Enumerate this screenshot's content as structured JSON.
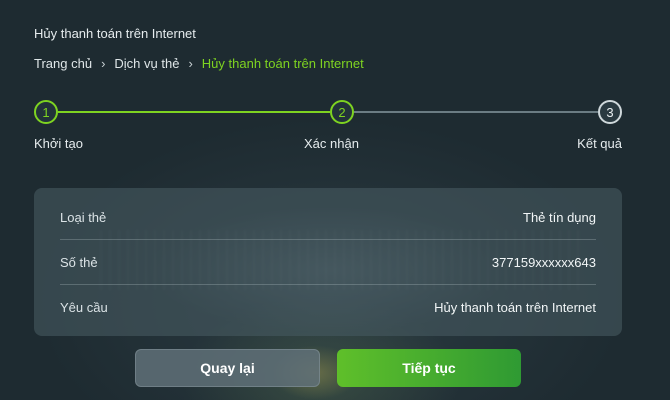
{
  "page": {
    "title": "Hủy thanh toán trên Internet"
  },
  "breadcrumb": {
    "items": [
      "Trang chủ",
      "Dịch vụ thẻ",
      "Hủy thanh toán trên Internet"
    ],
    "separator": "›"
  },
  "stepper": {
    "steps": [
      {
        "number": "1",
        "label": "Khởi tạo",
        "state": "done"
      },
      {
        "number": "2",
        "label": "Xác nhận",
        "state": "active"
      },
      {
        "number": "3",
        "label": "Kết quả",
        "state": "pending"
      }
    ]
  },
  "details": {
    "rows": [
      {
        "label": "Loại thẻ",
        "value": "Thẻ tín dụng"
      },
      {
        "label": "Số thẻ",
        "value": "377159xxxxxx643"
      },
      {
        "label": "Yêu cầu",
        "value": "Hủy thanh toán trên Internet"
      }
    ]
  },
  "actions": {
    "back_label": "Quay lại",
    "next_label": "Tiếp tục"
  },
  "colors": {
    "accent": "#7ed321",
    "button_primary": "#3aa52f",
    "background": "#1f2d33"
  }
}
